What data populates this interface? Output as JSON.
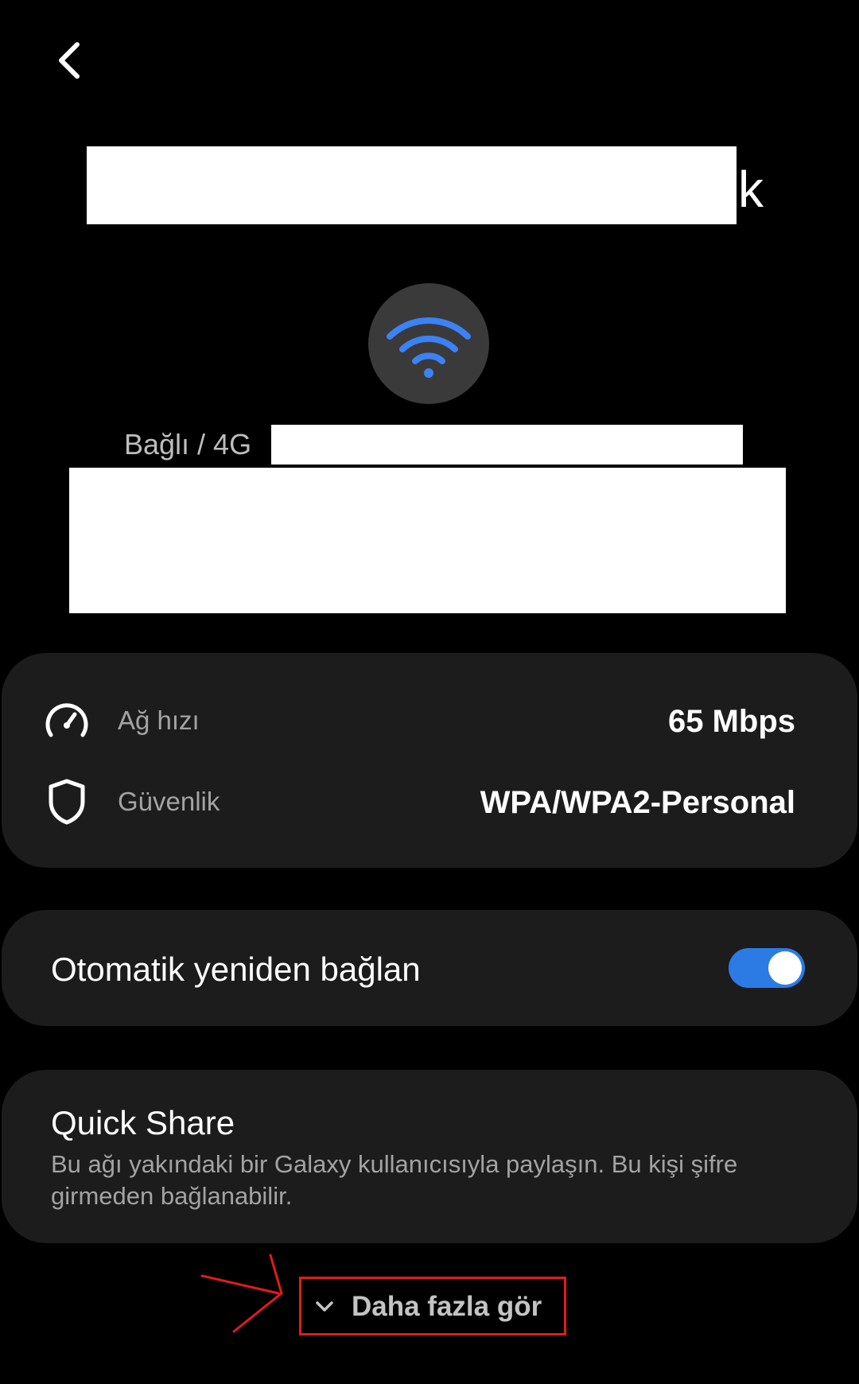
{
  "header": {
    "back_icon": "chevron-left-icon",
    "network_name_visible_suffix": "k"
  },
  "status": {
    "connection_text": "Bağlı / 4G",
    "wifi_icon": "wifi-icon",
    "wifi_color": "#3b82f6"
  },
  "details": {
    "rows": [
      {
        "icon": "speedometer-icon",
        "label": "Ağ hızı",
        "value": "65 Mbps"
      },
      {
        "icon": "shield-icon",
        "label": "Güvenlik",
        "value": "WPA/WPA2-Personal"
      }
    ]
  },
  "auto_reconnect": {
    "label": "Otomatik yeniden bağlan",
    "enabled": true,
    "toggle_color": "#2c7be5"
  },
  "quick_share": {
    "title": "Quick Share",
    "description": "Bu ağı yakındaki bir Galaxy kullanıcısıyla paylaşın. Bu kişi şifre girmeden bağlanabilir."
  },
  "see_more": {
    "label": "Daha fazla gör",
    "icon": "chevron-down-icon",
    "highlight_color": "#e21b1b"
  }
}
